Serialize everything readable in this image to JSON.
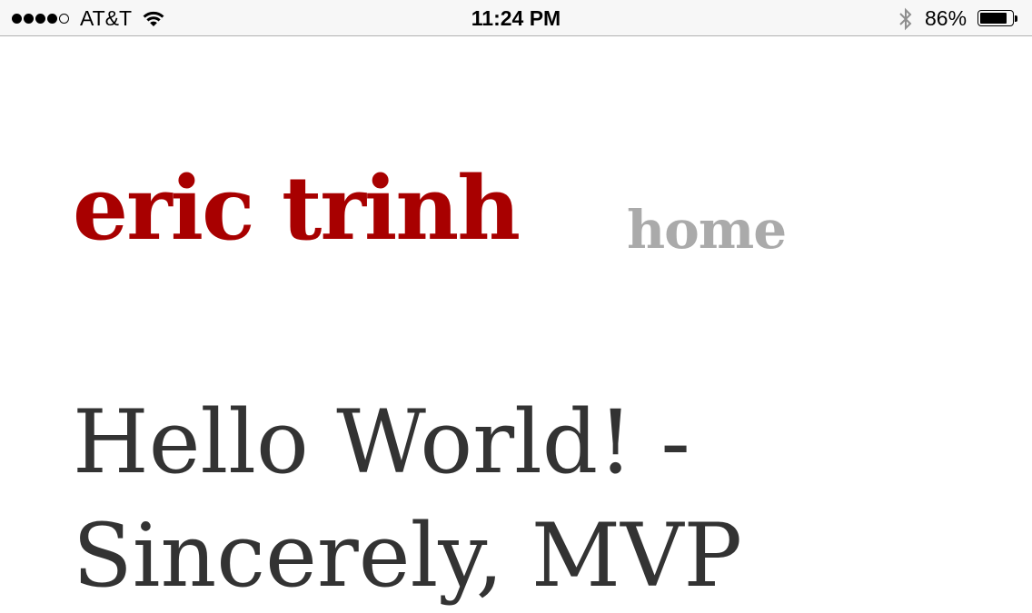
{
  "status_bar": {
    "signal_bars_filled": 4,
    "signal_bars_total": 5,
    "carrier": "AT&T",
    "wifi_icon": "wifi-icon",
    "time": "11:24 PM",
    "bluetooth_icon": "bluetooth-icon",
    "battery_percent_label": "86%",
    "battery_level": 0.86
  },
  "site": {
    "title": "eric trinh",
    "nav_home": "home"
  },
  "post": {
    "title_line1": "Hello World! -",
    "title_line2": "Sincerely, MVP"
  },
  "colors": {
    "brand_red": "#a80000",
    "nav_gray": "#aaaaaa",
    "text_dark": "#333333",
    "status_bar_bg": "#f7f7f7"
  }
}
